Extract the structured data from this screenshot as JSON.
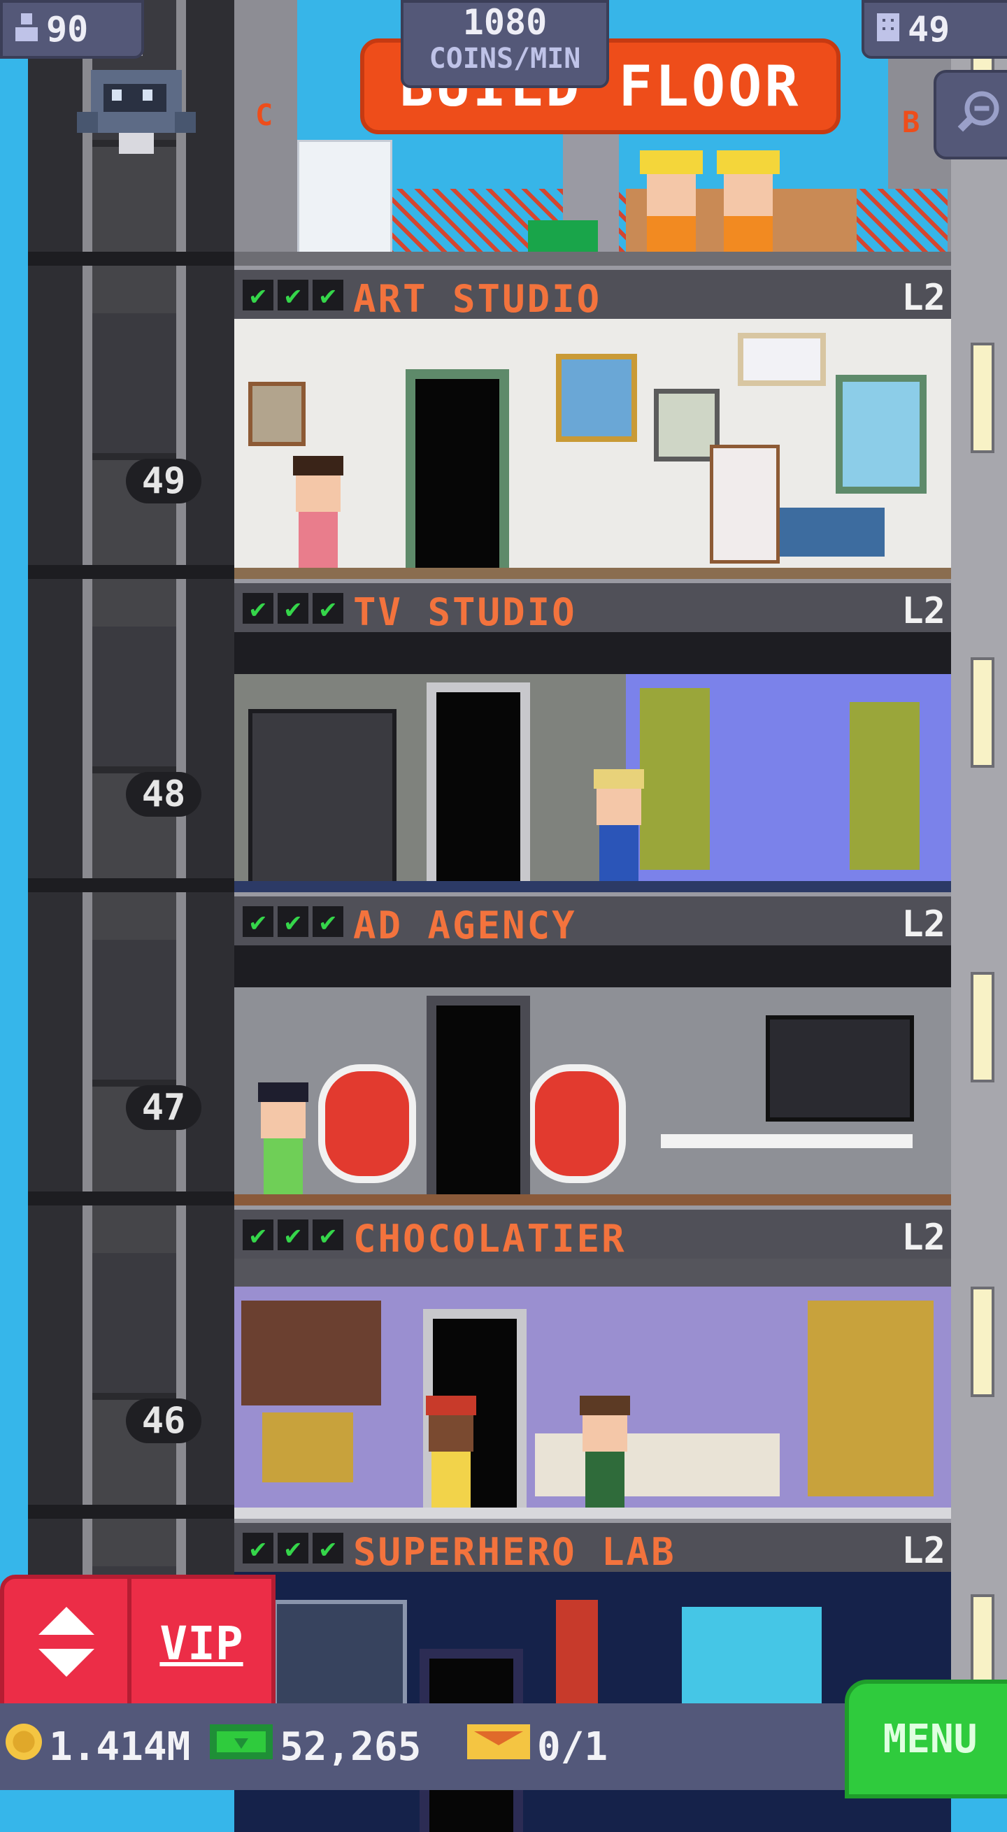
{
  "top_bar": {
    "population": "90",
    "coins_rate_value": "1080",
    "coins_rate_unit": "COINS/MIN",
    "floor_count": "49",
    "build_button_label": "BUILD FLOOR"
  },
  "construction_signs": {
    "left": "C",
    "right": "B"
  },
  "elevator": {
    "floor_numbers": [
      "49",
      "48",
      "47",
      "46"
    ]
  },
  "floors": [
    {
      "name": "ART STUDIO",
      "level": "L2"
    },
    {
      "name": "TV STUDIO",
      "level": "L2"
    },
    {
      "name": "AD AGENCY",
      "level": "L2"
    },
    {
      "name": "CHOCOLATIER",
      "level": "L2"
    },
    {
      "name": "SUPERHERO LAB",
      "level": "L2"
    }
  ],
  "check_glyph": "✔",
  "buttons": {
    "vip": "VIP",
    "menu": "MENU"
  },
  "resources": {
    "coins": "1.414M",
    "bux": "52,265",
    "tickets": "0/1"
  },
  "colors": {
    "build_button": "#ee4d1a",
    "floor_name": "#f3733d",
    "vip_button": "#ec2d47",
    "menu_button": "#2fcb3d"
  }
}
